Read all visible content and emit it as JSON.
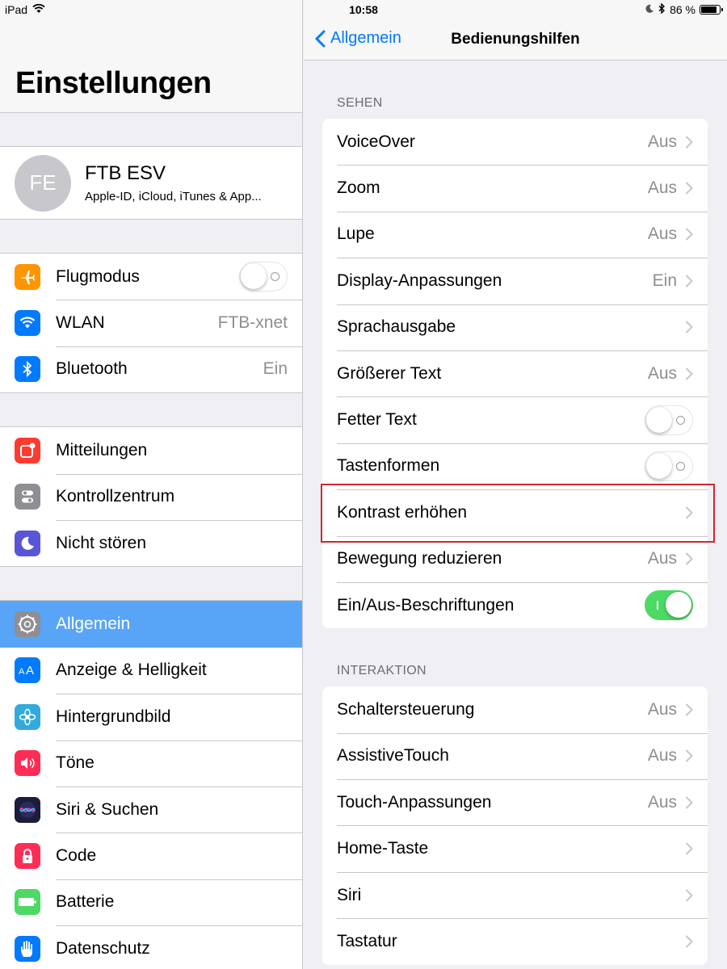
{
  "status": {
    "device": "iPad",
    "time": "10:58",
    "battery": "86 %",
    "battery_level": 0.86
  },
  "sidebar": {
    "title": "Einstellungen",
    "profile": {
      "initials": "FE",
      "name": "FTB ESV",
      "subtitle": "Apple-ID, iCloud, iTunes & App..."
    },
    "group1": [
      {
        "label": "Flugmodus",
        "icon": "airplane-icon",
        "color": "#ff9500"
      },
      {
        "label": "WLAN",
        "value": "FTB-xnet",
        "icon": "wifi-icon",
        "color": "#007aff"
      },
      {
        "label": "Bluetooth",
        "value": "Ein",
        "icon": "bluetooth-icon",
        "color": "#007aff"
      }
    ],
    "group2": [
      {
        "label": "Mitteilungen",
        "icon": "notifications-icon",
        "color": "#ff3b30"
      },
      {
        "label": "Kontrollzentrum",
        "icon": "control-center-icon",
        "color": "#8e8e93"
      },
      {
        "label": "Nicht stören",
        "icon": "moon-icon",
        "color": "#5856d6"
      }
    ],
    "group3": [
      {
        "label": "Allgemein",
        "icon": "gear-icon",
        "color": "#8e8e93",
        "selected": true
      },
      {
        "label": "Anzeige & Helligkeit",
        "icon": "display-icon",
        "color": "#007aff"
      },
      {
        "label": "Hintergrundbild",
        "icon": "wallpaper-icon",
        "color": "#34aadc"
      },
      {
        "label": "Töne",
        "icon": "sound-icon",
        "color": "#ff2d55"
      },
      {
        "label": "Siri & Suchen",
        "icon": "siri-icon",
        "color": "#1c1c3c"
      },
      {
        "label": "Code",
        "icon": "lock-icon",
        "color": "#ff2d55"
      },
      {
        "label": "Batterie",
        "icon": "battery-icon",
        "color": "#4cd964"
      },
      {
        "label": "Datenschutz",
        "icon": "hand-icon",
        "color": "#007aff"
      }
    ]
  },
  "detail": {
    "back_label": "Allgemein",
    "title": "Bedienungshilfen",
    "sections": [
      {
        "header": "SEHEN",
        "rows": [
          {
            "label": "VoiceOver",
            "value": "Aus"
          },
          {
            "label": "Zoom",
            "value": "Aus"
          },
          {
            "label": "Lupe",
            "value": "Aus"
          },
          {
            "label": "Display-Anpassungen",
            "value": "Ein"
          },
          {
            "label": "Sprachausgabe",
            "value": ""
          },
          {
            "label": "Größerer Text",
            "value": "Aus"
          },
          {
            "label": "Fetter Text",
            "toggle": false
          },
          {
            "label": "Tastenformen",
            "toggle": false
          },
          {
            "label": "Kontrast erhöhen",
            "value": ""
          },
          {
            "label": "Bewegung reduzieren",
            "value": "Aus"
          },
          {
            "label": "Ein/Aus-Beschriftungen",
            "toggle": true
          }
        ]
      },
      {
        "header": "INTERAKTION",
        "rows": [
          {
            "label": "Schaltersteuerung",
            "value": "Aus"
          },
          {
            "label": "AssistiveTouch",
            "value": "Aus"
          },
          {
            "label": "Touch-Anpassungen",
            "value": "Aus"
          },
          {
            "label": "Home-Taste",
            "value": ""
          },
          {
            "label": "Siri",
            "value": ""
          },
          {
            "label": "Tastatur",
            "value": ""
          }
        ]
      }
    ]
  }
}
